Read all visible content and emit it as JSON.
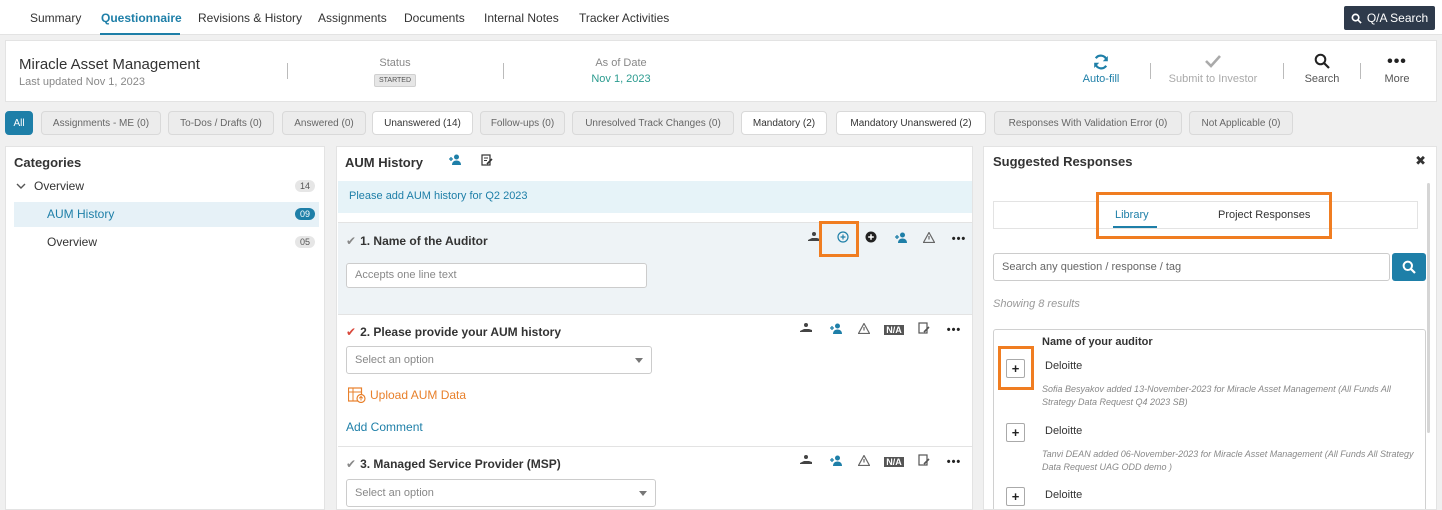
{
  "top_tabs": [
    "Summary",
    "Questionnaire",
    "Revisions & History",
    "Assignments",
    "Documents",
    "Internal Notes",
    "Tracker Activities"
  ],
  "qa_search_label": "Q/A Search",
  "header": {
    "company": "Miracle Asset Management",
    "last_updated": "Last updated Nov 1, 2023",
    "status_label": "Status",
    "status_value": "STARTED",
    "asof_label": "As of Date",
    "asof_value": "Nov 1, 2023",
    "actions": {
      "autofill": "Auto-fill",
      "submit": "Submit to Investor",
      "search": "Search",
      "more": "More"
    }
  },
  "filters": [
    "All",
    "Assignments - ME (0)",
    "To-Dos / Drafts (0)",
    "Answered (0)",
    "Unanswered (14)",
    "Follow-ups (0)",
    "Unresolved Track Changes (0)",
    "Mandatory (2)",
    "Mandatory Unanswered (2)",
    "Responses With Validation Error (0)",
    "Not Applicable (0)"
  ],
  "categories": {
    "title": "Categories",
    "items": [
      {
        "label": "Overview",
        "count": "14"
      },
      {
        "label": "AUM History",
        "count": "09"
      },
      {
        "label": "Overview",
        "count": "05"
      }
    ]
  },
  "questions_panel": {
    "title": "AUM History",
    "info": "Please add AUM history for Q2 2023",
    "q1": {
      "title": "1. Name of the Auditor",
      "placeholder": "Accepts one line text"
    },
    "q2": {
      "title": "2. Please provide your AUM history",
      "placeholder": "Select an option",
      "upload": "Upload AUM Data",
      "comment": "Add Comment",
      "na": "N/A"
    },
    "q3": {
      "title": "3. Managed Service Provider (MSP)",
      "placeholder": "Select an option",
      "na": "N/A"
    }
  },
  "suggested": {
    "title": "Suggested Responses",
    "tabs": [
      "Library",
      "Project Responses"
    ],
    "search_placeholder": "Search any question / response / tag",
    "showing": "Showing 8 results",
    "question": "Name of your auditor",
    "results": [
      {
        "answer": "Deloitte",
        "meta": "Sofia Besyakov added 13-November-2023 for Miracle Asset Management (All Funds All Strategy Data Request Q4 2023 SB)"
      },
      {
        "answer": "Deloitte",
        "meta": "Tanvi DEAN added 06-November-2023 for Miracle Asset Management (All Funds All Strategy Data Request UAG ODD demo )"
      },
      {
        "answer": "Deloitte",
        "meta": ""
      }
    ]
  },
  "colors": {
    "accent": "#1e7fa8",
    "highlight": "#f07d21",
    "teal": "#2b9b8f",
    "dark": "#2e3a4b"
  }
}
